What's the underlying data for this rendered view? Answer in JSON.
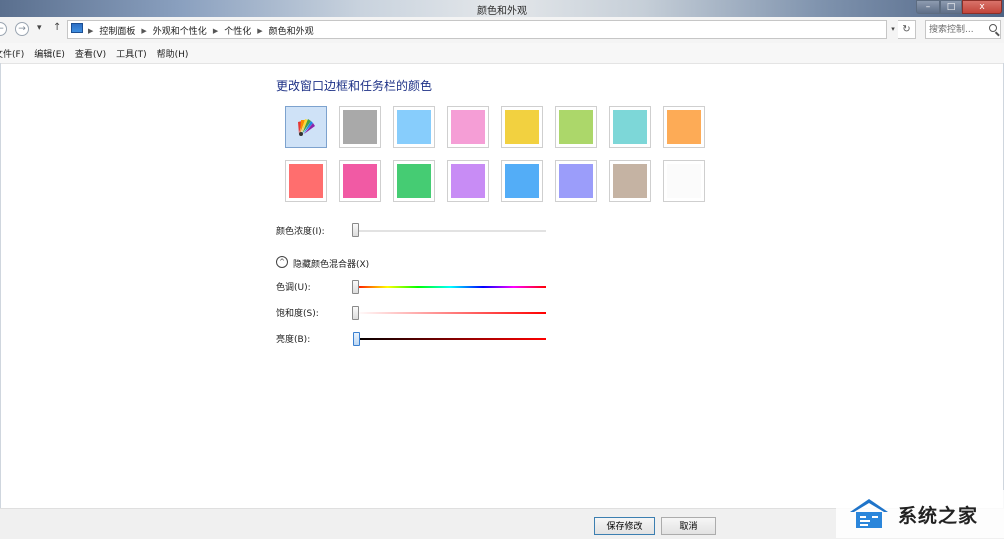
{
  "window": {
    "title": "颜色和外观"
  },
  "titlebar_buttons": {
    "minimize": "–",
    "maximize": "□",
    "close": "x"
  },
  "nav": {
    "back": "←",
    "forward": "→",
    "recent": "▾",
    "up": "↑"
  },
  "breadcrumbs": [
    "控制面板",
    "外观和个性化",
    "个性化",
    "颜色和外观"
  ],
  "search": {
    "placeholder": "搜索控制..."
  },
  "menu": [
    "文件(F)",
    "编辑(E)",
    "查看(V)",
    "工具(T)",
    "帮助(H)"
  ],
  "heading": "更改窗口边框和任务栏的颜色",
  "swatches": [
    {
      "name": "auto",
      "color": "#cfe2f7",
      "selected": true
    },
    {
      "name": "gray",
      "color": "#a9a9a9"
    },
    {
      "name": "light-blue",
      "color": "#87cdfc"
    },
    {
      "name": "pink",
      "color": "#f59ed6"
    },
    {
      "name": "yellow",
      "color": "#f2d140"
    },
    {
      "name": "lime",
      "color": "#acd76a"
    },
    {
      "name": "teal",
      "color": "#7dd7d8"
    },
    {
      "name": "orange",
      "color": "#fdab56"
    },
    {
      "name": "red",
      "color": "#ff6e6e"
    },
    {
      "name": "magenta",
      "color": "#f15aa4"
    },
    {
      "name": "green",
      "color": "#45cc73"
    },
    {
      "name": "violet",
      "color": "#c88cf5"
    },
    {
      "name": "blue",
      "color": "#53adf7"
    },
    {
      "name": "periwinkle",
      "color": "#9b9dfa"
    },
    {
      "name": "taupe",
      "color": "#c5b3a3"
    },
    {
      "name": "white",
      "color": "#fbfbfb"
    }
  ],
  "intensity": {
    "label": "颜色浓度(I):",
    "value": 0
  },
  "mixer": {
    "toggle_label": "隐藏颜色混合器(X)",
    "toggle_icon": "^"
  },
  "hue": {
    "label": "色调(U):",
    "value": 0
  },
  "saturation": {
    "label": "饱和度(S):",
    "value": 0
  },
  "brightness": {
    "label": "亮度(B):",
    "value": 0
  },
  "buttons": {
    "save": "保存修改",
    "cancel": "取消"
  },
  "watermark": {
    "text": "系统之家"
  }
}
